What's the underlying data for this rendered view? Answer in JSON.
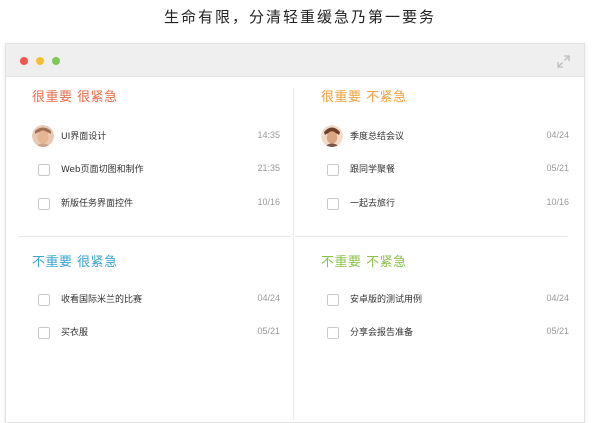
{
  "heading": "生命有限，分清轻重缓急乃第一要务",
  "window_icons": {
    "close": "close-light",
    "minimize": "minimize-light",
    "maximize": "maximize-light",
    "expand": "expand-icon"
  },
  "colors": {
    "q1": "#e96e49",
    "q2": "#f0a03a",
    "q3": "#3aa4cf",
    "q4": "#8bc24a"
  },
  "quadrants": [
    {
      "title": "很重要 很紧急",
      "tasks": [
        {
          "label": "UI界面设计",
          "date": "14:35",
          "marker": "avatar"
        },
        {
          "label": "Web页面切图和制作",
          "date": "21:35",
          "marker": "checkbox"
        },
        {
          "label": "新版任务界面控件",
          "date": "10/16",
          "marker": "checkbox"
        }
      ]
    },
    {
      "title": "很重要 不紧急",
      "tasks": [
        {
          "label": "季度总结会议",
          "date": "04/24",
          "marker": "avatar"
        },
        {
          "label": "跟同学聚餐",
          "date": "05/21",
          "marker": "checkbox"
        },
        {
          "label": "一起去旅行",
          "date": "10/16",
          "marker": "checkbox"
        }
      ]
    },
    {
      "title": "不重要 很紧急",
      "tasks": [
        {
          "label": "收看国际米兰的比赛",
          "date": "04/24",
          "marker": "checkbox"
        },
        {
          "label": "买衣服",
          "date": "05/21",
          "marker": "checkbox"
        }
      ]
    },
    {
      "title": "不重要 不紧急",
      "tasks": [
        {
          "label": "安卓版的测试用例",
          "date": "04/24",
          "marker": "checkbox"
        },
        {
          "label": "分享会报告准备",
          "date": "05/21",
          "marker": "checkbox"
        }
      ]
    }
  ]
}
